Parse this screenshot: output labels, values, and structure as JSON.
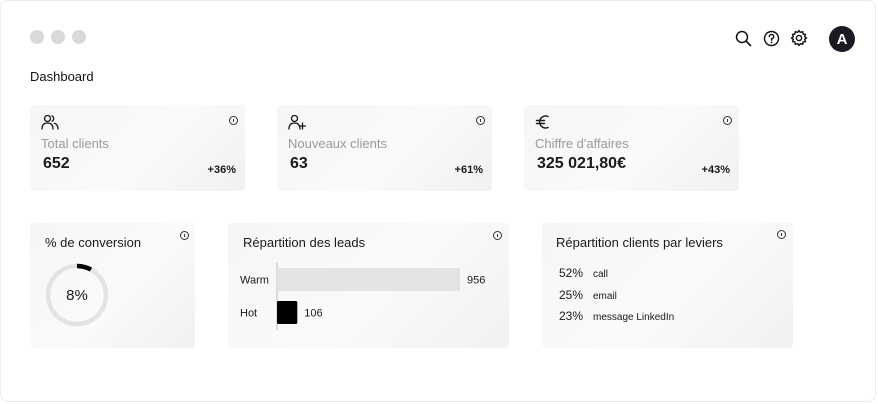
{
  "window": {
    "controls": [
      "close",
      "minimize",
      "maximize"
    ]
  },
  "header": {
    "icons": [
      "search-icon",
      "help-icon",
      "gear-icon"
    ],
    "avatar_initial": "A"
  },
  "page": {
    "title": "Dashboard"
  },
  "kpis": [
    {
      "icon": "users-icon",
      "label": "Total clients",
      "value": "652",
      "delta": "+36%"
    },
    {
      "icon": "user-plus-icon",
      "label": "Nouveaux clients",
      "value": "63",
      "delta": "+61%"
    },
    {
      "icon": "euro-icon",
      "label": "Chiffre d'affaires",
      "value": "325 021,80€",
      "delta": "+43%"
    }
  ],
  "conversion": {
    "title": "% de conversion",
    "value_label": "8%",
    "value": 0.08
  },
  "leads": {
    "title": "Répartition des leads",
    "chart_data": {
      "type": "bar",
      "orientation": "horizontal",
      "categories": [
        "Warm",
        "Hot"
      ],
      "values": [
        956,
        106
      ],
      "value_labels": [
        "956",
        "106"
      ],
      "colors": [
        "#e3e3e3",
        "#000000"
      ]
    }
  },
  "levers": {
    "title": "Répartition clients par leviers",
    "items": [
      {
        "pct": "52%",
        "name": "call"
      },
      {
        "pct": "25%",
        "name": "email"
      },
      {
        "pct": "23%",
        "name": "message LinkedIn"
      }
    ]
  },
  "colors": {
    "accent": "#1b1a20",
    "muted": "#9a9a9a",
    "ring_track": "#e3e3e3"
  }
}
